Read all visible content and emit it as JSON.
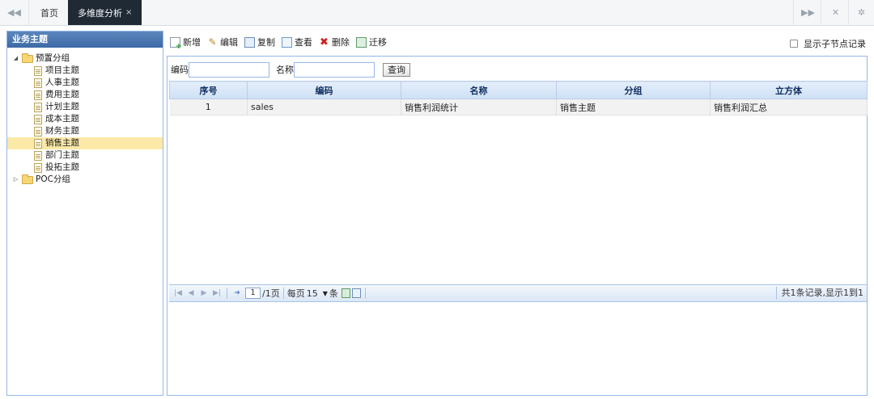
{
  "topbar": {
    "tabs": [
      {
        "label": "首页"
      },
      {
        "label": "多维度分析",
        "close": "×"
      }
    ],
    "icons": [
      "rewind-icon",
      "fast-forward-icon",
      "fullscreen-icon",
      "settings-icon"
    ]
  },
  "sidebar": {
    "title": "业务主题",
    "tree": [
      {
        "label": "预置分组",
        "children": [
          {
            "label": "项目主题"
          },
          {
            "label": "人事主题"
          },
          {
            "label": "费用主题"
          },
          {
            "label": "计划主题"
          },
          {
            "label": "成本主题"
          },
          {
            "label": "财务主题"
          },
          {
            "label": "销售主题",
            "selected": true
          },
          {
            "label": "部门主题"
          },
          {
            "label": "投拓主题"
          }
        ]
      },
      {
        "label": "POC分组"
      }
    ]
  },
  "toolbar": {
    "add": "新增",
    "edit": "编辑",
    "copy": "复制",
    "view": "查看",
    "delete": "删除",
    "migrate": "迁移",
    "show_children": "显示子节点记录"
  },
  "search": {
    "code_label": "编码",
    "code_value": "",
    "name_label": "名称",
    "name_value": "",
    "button": "查询"
  },
  "grid": {
    "columns": [
      "序号",
      "编码",
      "名称",
      "分组",
      "立方体"
    ],
    "rows": [
      [
        "1",
        "sales",
        "销售利润统计",
        "销售主题",
        "销售利润汇总"
      ]
    ]
  },
  "pager": {
    "page": "1",
    "total_pages": "/1页",
    "per_page_label": "每页",
    "per_page": "15",
    "unit": "条",
    "summary": "共1条记录,显示1到1"
  },
  "colors": {
    "accent": "#95b8e7",
    "active_tab": "#1f2a35",
    "selected_node": "#fbe9a8",
    "panel_header": "#3e6aa6"
  }
}
